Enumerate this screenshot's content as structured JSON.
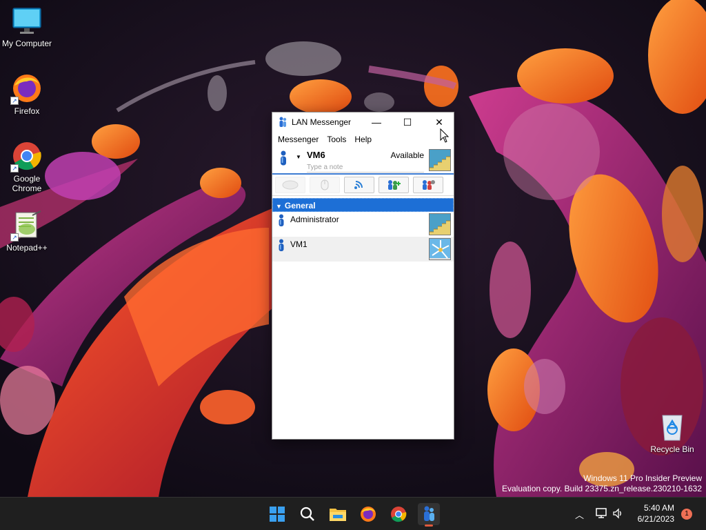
{
  "desktop": {
    "icons": [
      {
        "label": "My Computer",
        "icon": "monitor-icon"
      },
      {
        "label": "Firefox",
        "icon": "firefox-icon"
      },
      {
        "label": "Google Chrome",
        "icon": "chrome-icon"
      },
      {
        "label": "Notepad++",
        "icon": "notepadpp-icon"
      },
      {
        "label": "Recycle Bin",
        "icon": "recycle-bin-icon"
      }
    ],
    "watermark": {
      "line1": "Windows 11 Pro Insider Preview",
      "line2": "Evaluation copy. Build 23375.zn_release.230210-1632"
    }
  },
  "window": {
    "title": "LAN Messenger",
    "controls": {
      "minimize": "minimize-icon",
      "maximize": "maximize-icon",
      "close": "close-icon"
    },
    "menu": [
      "Messenger",
      "Tools",
      "Help"
    ],
    "user": {
      "name": "VM6",
      "status": "Available",
      "note_placeholder": "Type a note",
      "note_value": ""
    },
    "toolbar": [
      {
        "icon": "chat-bubble-icon",
        "enabled": false
      },
      {
        "icon": "mouse-icon",
        "enabled": false
      },
      {
        "icon": "broadcast-icon",
        "enabled": true
      },
      {
        "icon": "group-add-icon",
        "enabled": true
      },
      {
        "icon": "group-settings-icon",
        "enabled": true
      }
    ],
    "group": {
      "name": "General",
      "contacts": [
        {
          "name": "Administrator",
          "avatar": "stairs-avatar"
        },
        {
          "name": "VM1",
          "avatar": "windmill-avatar"
        }
      ]
    }
  },
  "taskbar": {
    "apps": [
      "start-icon",
      "search-icon",
      "file-explorer-icon",
      "firefox-icon",
      "chrome-icon",
      "lan-messenger-icon"
    ],
    "active_app": "lan-messenger-icon",
    "tray": {
      "overflow": "chevron-up-icon",
      "network": "network-icon",
      "volume": "volume-icon"
    },
    "time": "5:40 AM",
    "date": "6/21/2023",
    "notification_count": "1"
  },
  "colors": {
    "accent": "#1d6fd6",
    "taskbar_bg": "#1f1f1f",
    "badge": "#ef6f55"
  }
}
